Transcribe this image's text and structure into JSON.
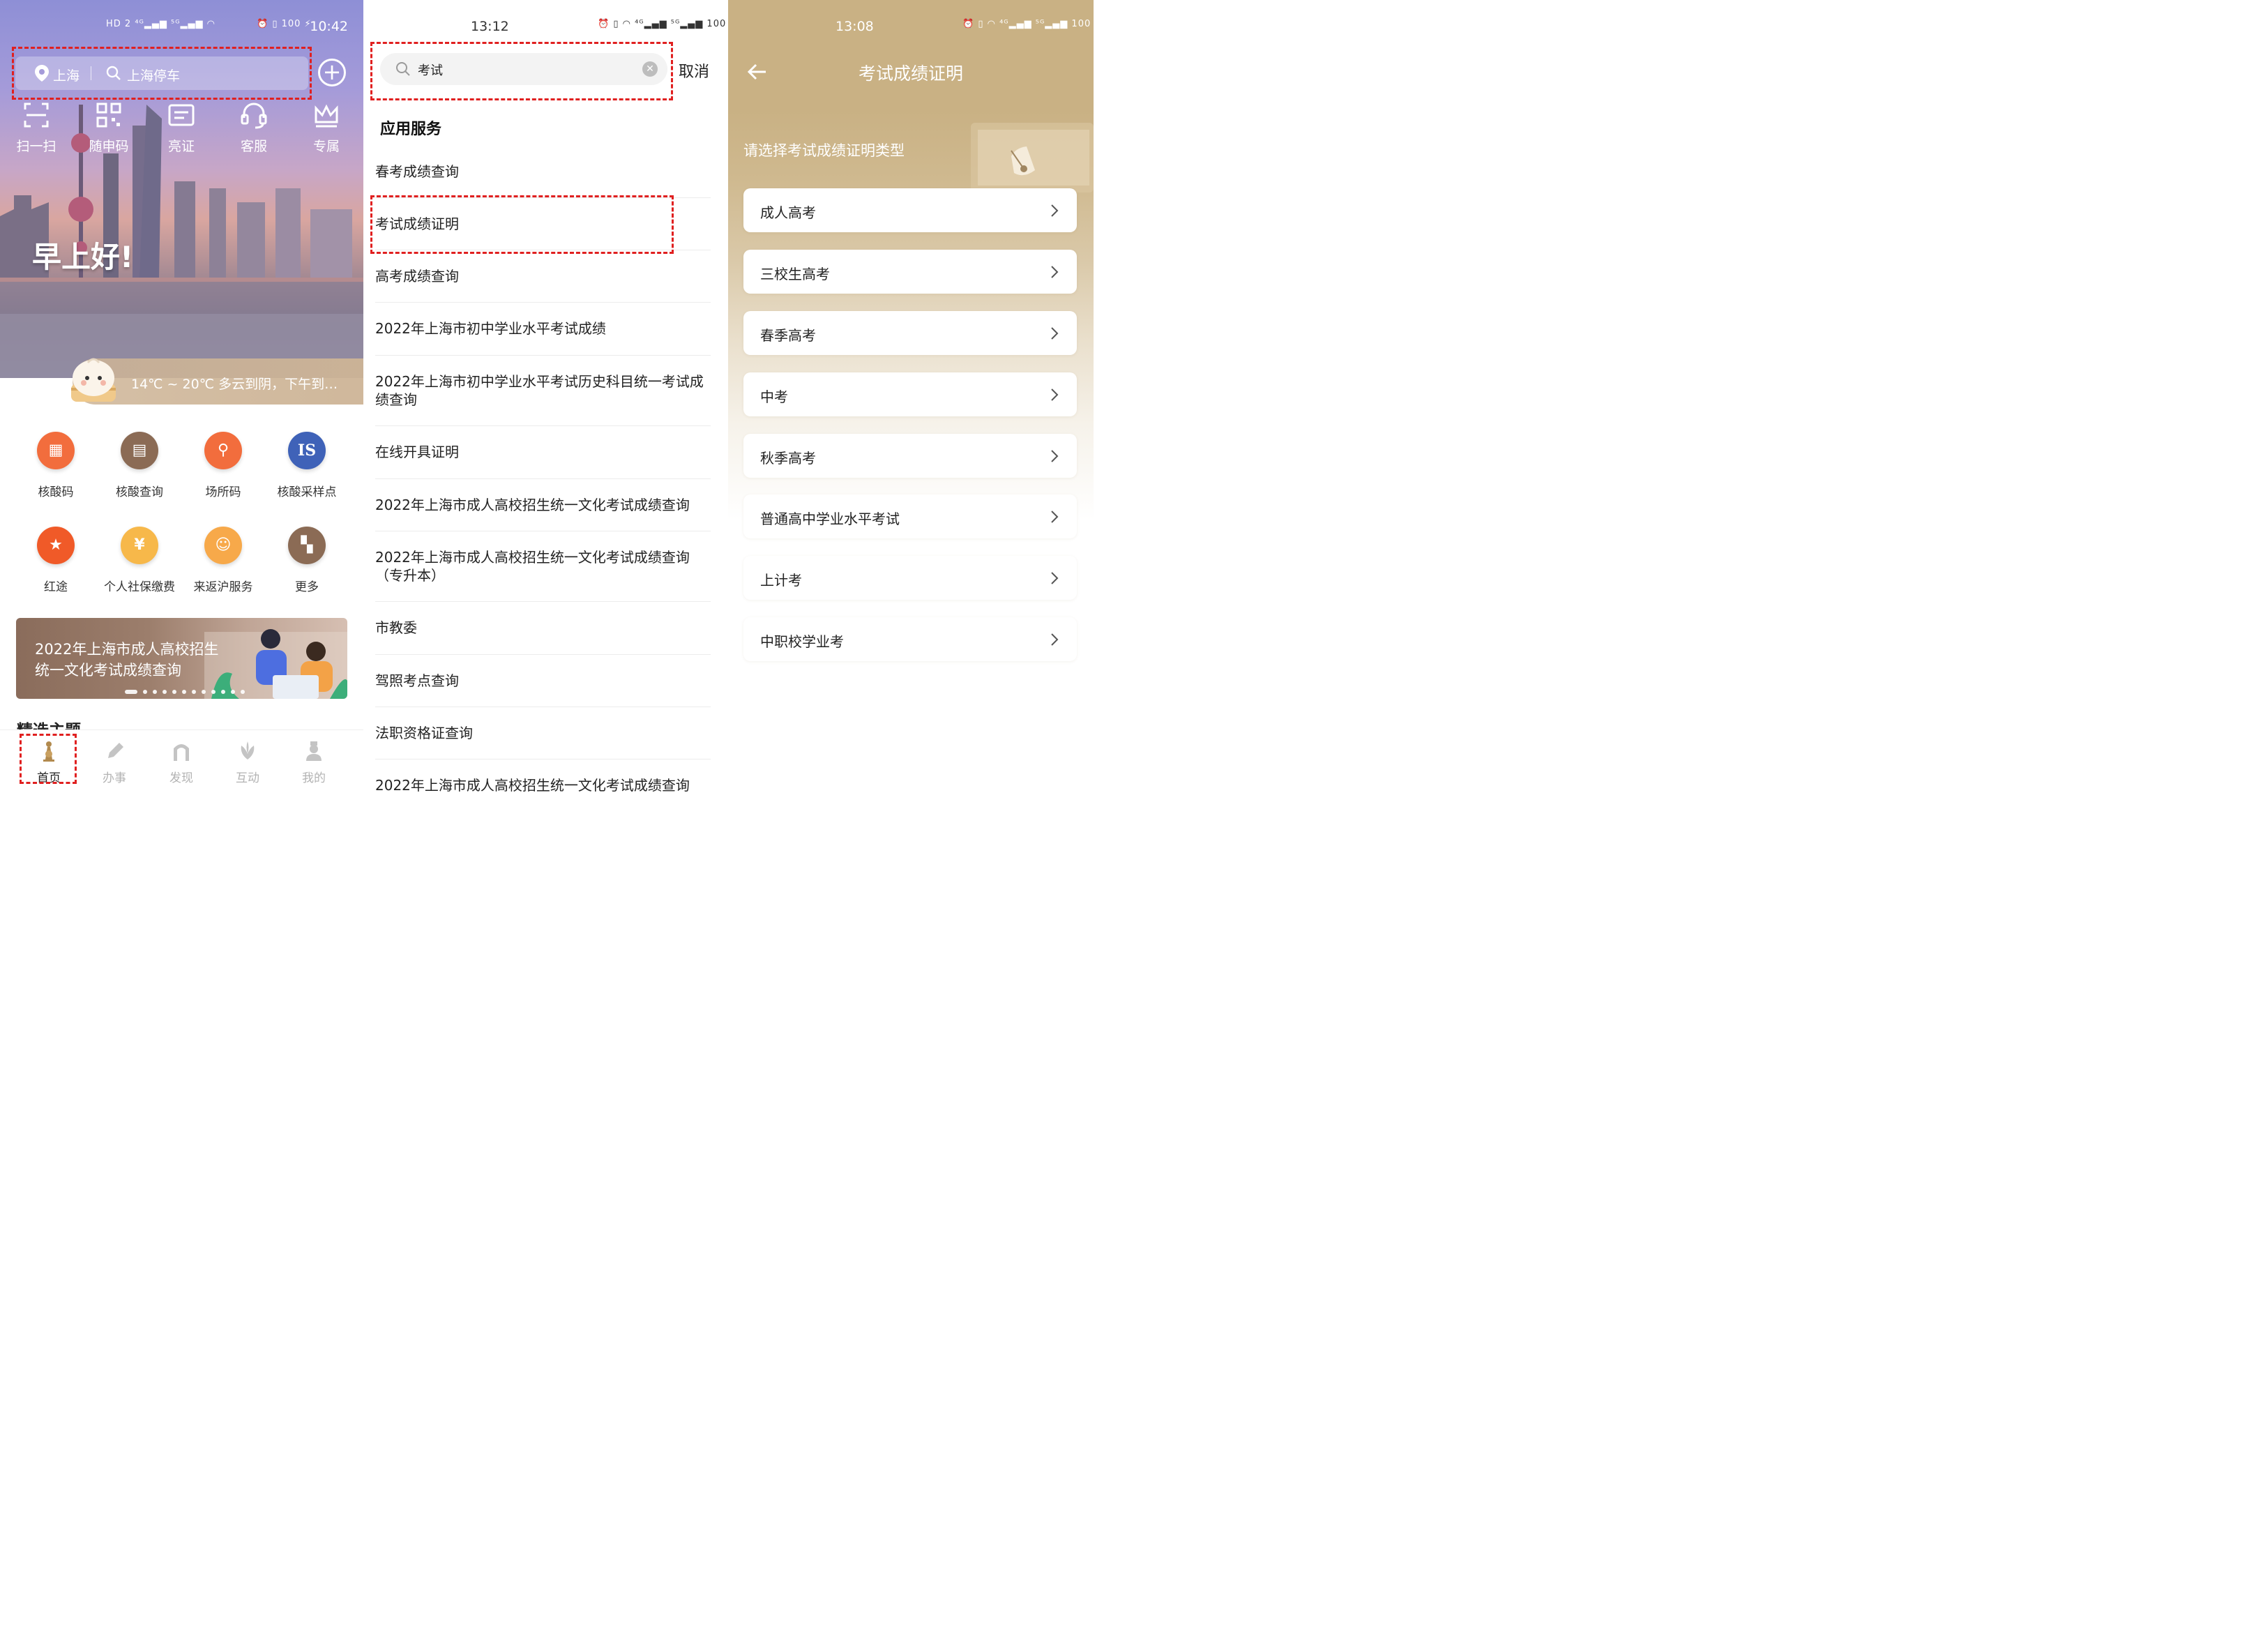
{
  "screen1": {
    "status": {
      "left_icons": "HD 2 ⁴ᴳ▂▄▆ ⁵ᴳ▂▄▆ ◠",
      "right_icons": "⏰ ▯ 100 ⚡",
      "time": "10:42"
    },
    "search": {
      "city": "上海",
      "query": "上海停车"
    },
    "quick_actions": [
      "扫一扫",
      "随申码",
      "亮证",
      "客服",
      "专属"
    ],
    "greeting": "早上好!",
    "weather": "14℃ ~ 20℃  多云到阴，下午到…",
    "services": [
      {
        "label": "核酸码",
        "icon": "qr-icon",
        "color": "#f26d3d"
      },
      {
        "label": "核酸查询",
        "icon": "document-icon",
        "color": "#8b6b55"
      },
      {
        "label": "场所码",
        "icon": "location-icon",
        "color": "#f26d3d"
      },
      {
        "label": "核酸采样点",
        "icon": "is-icon",
        "color": "#3f62b8"
      },
      {
        "label": "红途",
        "icon": "star-icon",
        "color": "#f05a28"
      },
      {
        "label": "个人社保缴费",
        "icon": "social-security-icon",
        "color": "#f7b84a"
      },
      {
        "label": "来返沪服务",
        "icon": "person-icon",
        "color": "#f7a94a"
      },
      {
        "label": "更多",
        "icon": "grid-more-icon",
        "color": "#8b6b55"
      }
    ],
    "banner": {
      "text": "2022年上海市成人高校招生统一文化考试成绩查询"
    },
    "section_title": "精选主题",
    "tabs": [
      "首页",
      "办事",
      "发现",
      "互动",
      "我的"
    ]
  },
  "screen2": {
    "status": {
      "time": "13:12",
      "icons": "⏰ ▯ ◠ ⁴ᴳ▂▄▆ ⁵ᴳ▂▄▆ 100 ⚡"
    },
    "search_value": "考试",
    "cancel": "取消",
    "section": "应用服务",
    "results": [
      "春考成绩查询",
      "考试成绩证明",
      "高考成绩查询",
      "2022年上海市初中学业水平考试成绩",
      "2022年上海市初中学业水平考试历史科目统一考试成绩查询",
      "在线开具证明",
      "2022年上海市成人高校招生统一文化考试成绩查询",
      "2022年上海市成人高校招生统一文化考试成绩查询（专升本）",
      "市教委",
      "驾照考点查询",
      "法职资格证查询",
      "2022年上海市成人高校招生统一文化考试成绩查询"
    ]
  },
  "screen3": {
    "status": {
      "time": "13:08",
      "icons": "⏰ ▯ ◠ ⁴ᴳ▂▄▆ ⁵ᴳ▂▄▆ 100 ⚡"
    },
    "title": "考试成绩证明",
    "prompt": "请选择考试成绩证明类型",
    "options": [
      "成人高考",
      "三校生高考",
      "春季高考",
      "中考",
      "秋季高考",
      "普通高中学业水平考试",
      "上计考",
      "中职校学业考"
    ]
  },
  "colors": {
    "accent_gold": "#c9b184",
    "highlight_red": "#e02020"
  }
}
